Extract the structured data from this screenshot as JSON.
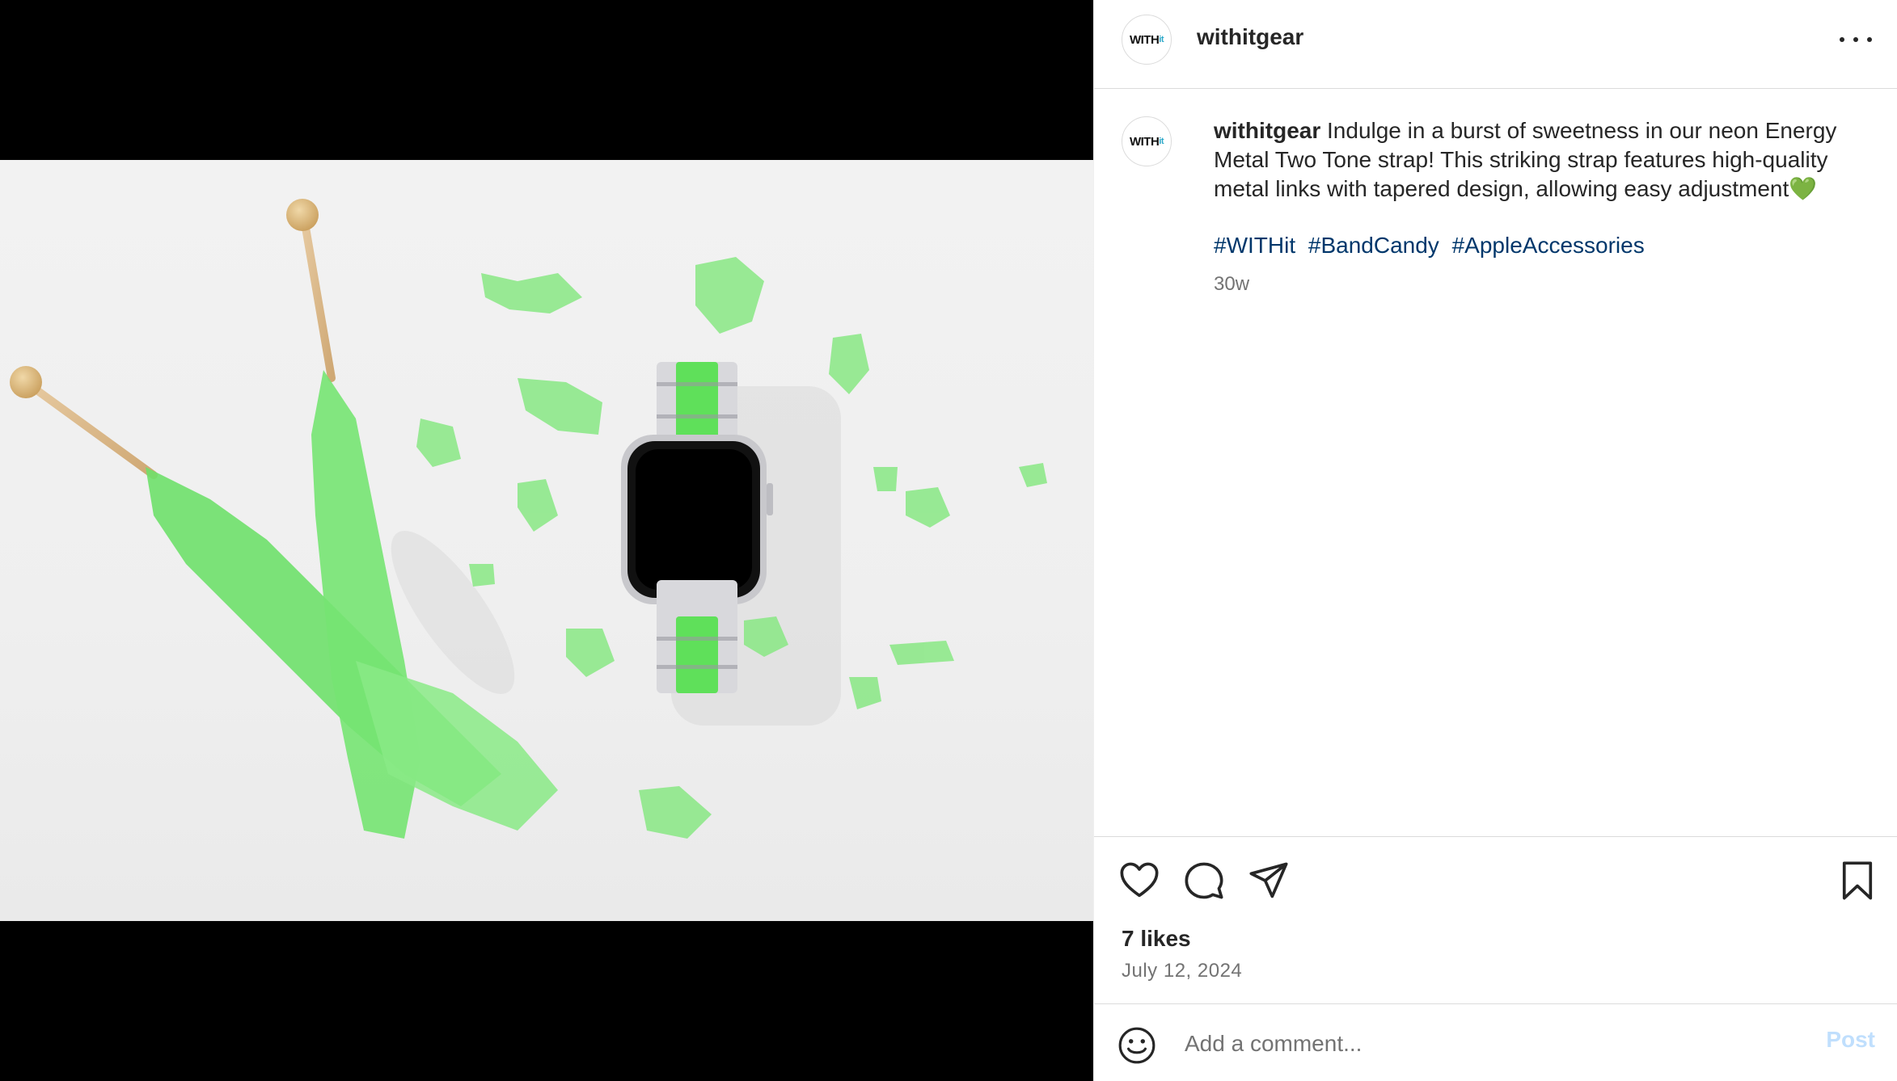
{
  "post": {
    "username": "withitgear",
    "avatar_text": "WITH",
    "avatar_accent": "it",
    "caption": "Indulge in a burst of sweetness in our neon Energy Metal Two Tone strap! This striking strap features high-quality metal links with tapered design, allowing easy adjustment",
    "caption_emoji": "💚",
    "hashtags": [
      "#WITHit",
      "#BandCandy",
      "#AppleAccessories"
    ],
    "time_ago": "30w",
    "likes": "7 likes",
    "date": "July 12, 2024"
  },
  "comment": {
    "placeholder": "Add a comment...",
    "post_label": "Post"
  },
  "icons": {
    "more": "more-options-icon",
    "like": "heart-icon",
    "comment": "comment-bubble-icon",
    "share": "paper-plane-icon",
    "save": "bookmark-icon",
    "emoji": "smiley-icon"
  },
  "colors": {
    "hashtag": "#00376b",
    "post_button_disabled": "#c0dffd",
    "secondary_text": "#737373",
    "neon_green": "#5fe05a"
  }
}
